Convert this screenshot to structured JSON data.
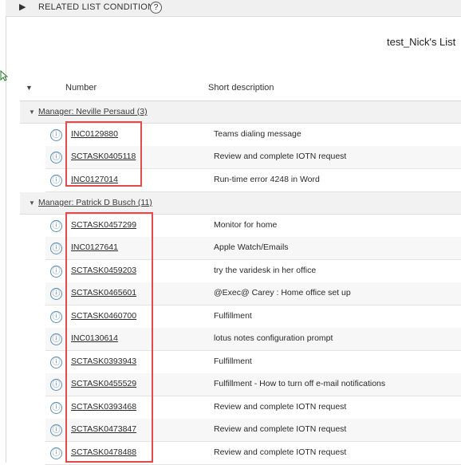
{
  "related_list": {
    "toggle_glyph": "▶",
    "label": "RELATED LIST CONDITIONS",
    "help_glyph": "?"
  },
  "list_title": "test_Nick's List",
  "columns": {
    "caret_glyph": "▼",
    "number": "Number",
    "short_description": "Short description"
  },
  "groups": [
    {
      "label": "Manager: Neville Persaud (3)",
      "rows": [
        {
          "number": "INC0129880",
          "short_description": "Teams dialing message"
        },
        {
          "number": "SCTASK0405118",
          "short_description": "Review and complete IOTN request"
        },
        {
          "number": "INC0127014",
          "short_description": "Run-time error 4248 in Word"
        }
      ]
    },
    {
      "label": "Manager: Patrick D Busch (11)",
      "rows": [
        {
          "number": "SCTASK0457299",
          "short_description": "Monitor for home"
        },
        {
          "number": "INC0127641",
          "short_description": "Apple Watch/Emails"
        },
        {
          "number": "SCTASK0459203",
          "short_description": "try the varidesk in her office"
        },
        {
          "number": "SCTASK0465601",
          "short_description": "@Exec@ Carey : Home office set up"
        },
        {
          "number": "SCTASK0460700",
          "short_description": "Fulfillment"
        },
        {
          "number": "INC0130614",
          "short_description": "lotus notes configuration prompt"
        },
        {
          "number": "SCTASK0393943",
          "short_description": "Fulfillment"
        },
        {
          "number": "SCTASK0455529",
          "short_description": "Fulfillment - How to turn off e-mail notifications"
        },
        {
          "number": "SCTASK0393468",
          "short_description": "Review and complete IOTN request"
        },
        {
          "number": "SCTASK0473847",
          "short_description": "Review and complete IOTN request"
        },
        {
          "number": "SCTASK0478488",
          "short_description": "Review and complete IOTN request"
        }
      ]
    }
  ],
  "icons": {
    "info": "ⓘ",
    "group_caret": "▼"
  },
  "colors": {
    "highlight": "#e24b4b",
    "info_icon": "#5f8fb4",
    "group_bg": "#f2f2f2"
  }
}
